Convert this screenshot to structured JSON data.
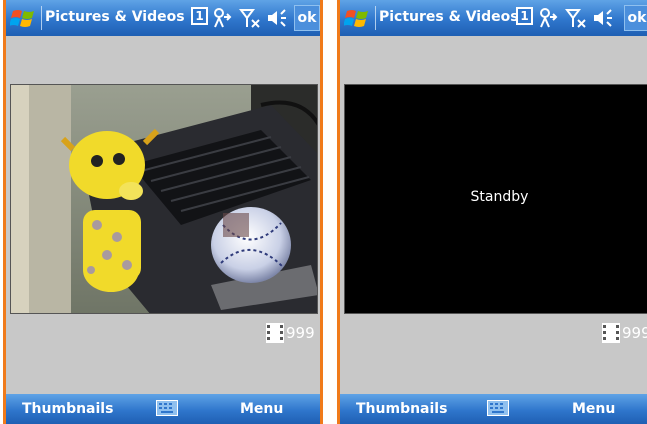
{
  "left_screen": {
    "title": "Pictures & Videos",
    "indicator_1": "1",
    "ok_label": "ok",
    "counter": "999",
    "softkey_left": "Thumbnails",
    "softkey_right": "Menu"
  },
  "right_screen": {
    "title": "Pictures & Videos",
    "indicator_1": "1",
    "ok_label": "ok",
    "standby_text": "Standby",
    "counter": "999",
    "softkey_left": "Thumbnails",
    "softkey_right": "Menu"
  },
  "icons": {
    "start": "windows-flag-icon",
    "connectivity": "connectivity-icon",
    "signal": "signal-off-icon",
    "volume": "speaker-icon",
    "keyboard": "keyboard-icon",
    "film": "film-icon"
  },
  "colors": {
    "title_bar": "#2f76cc",
    "frame": "#f07a1a",
    "background": "#c8c8c8",
    "viewer": "#000000"
  }
}
